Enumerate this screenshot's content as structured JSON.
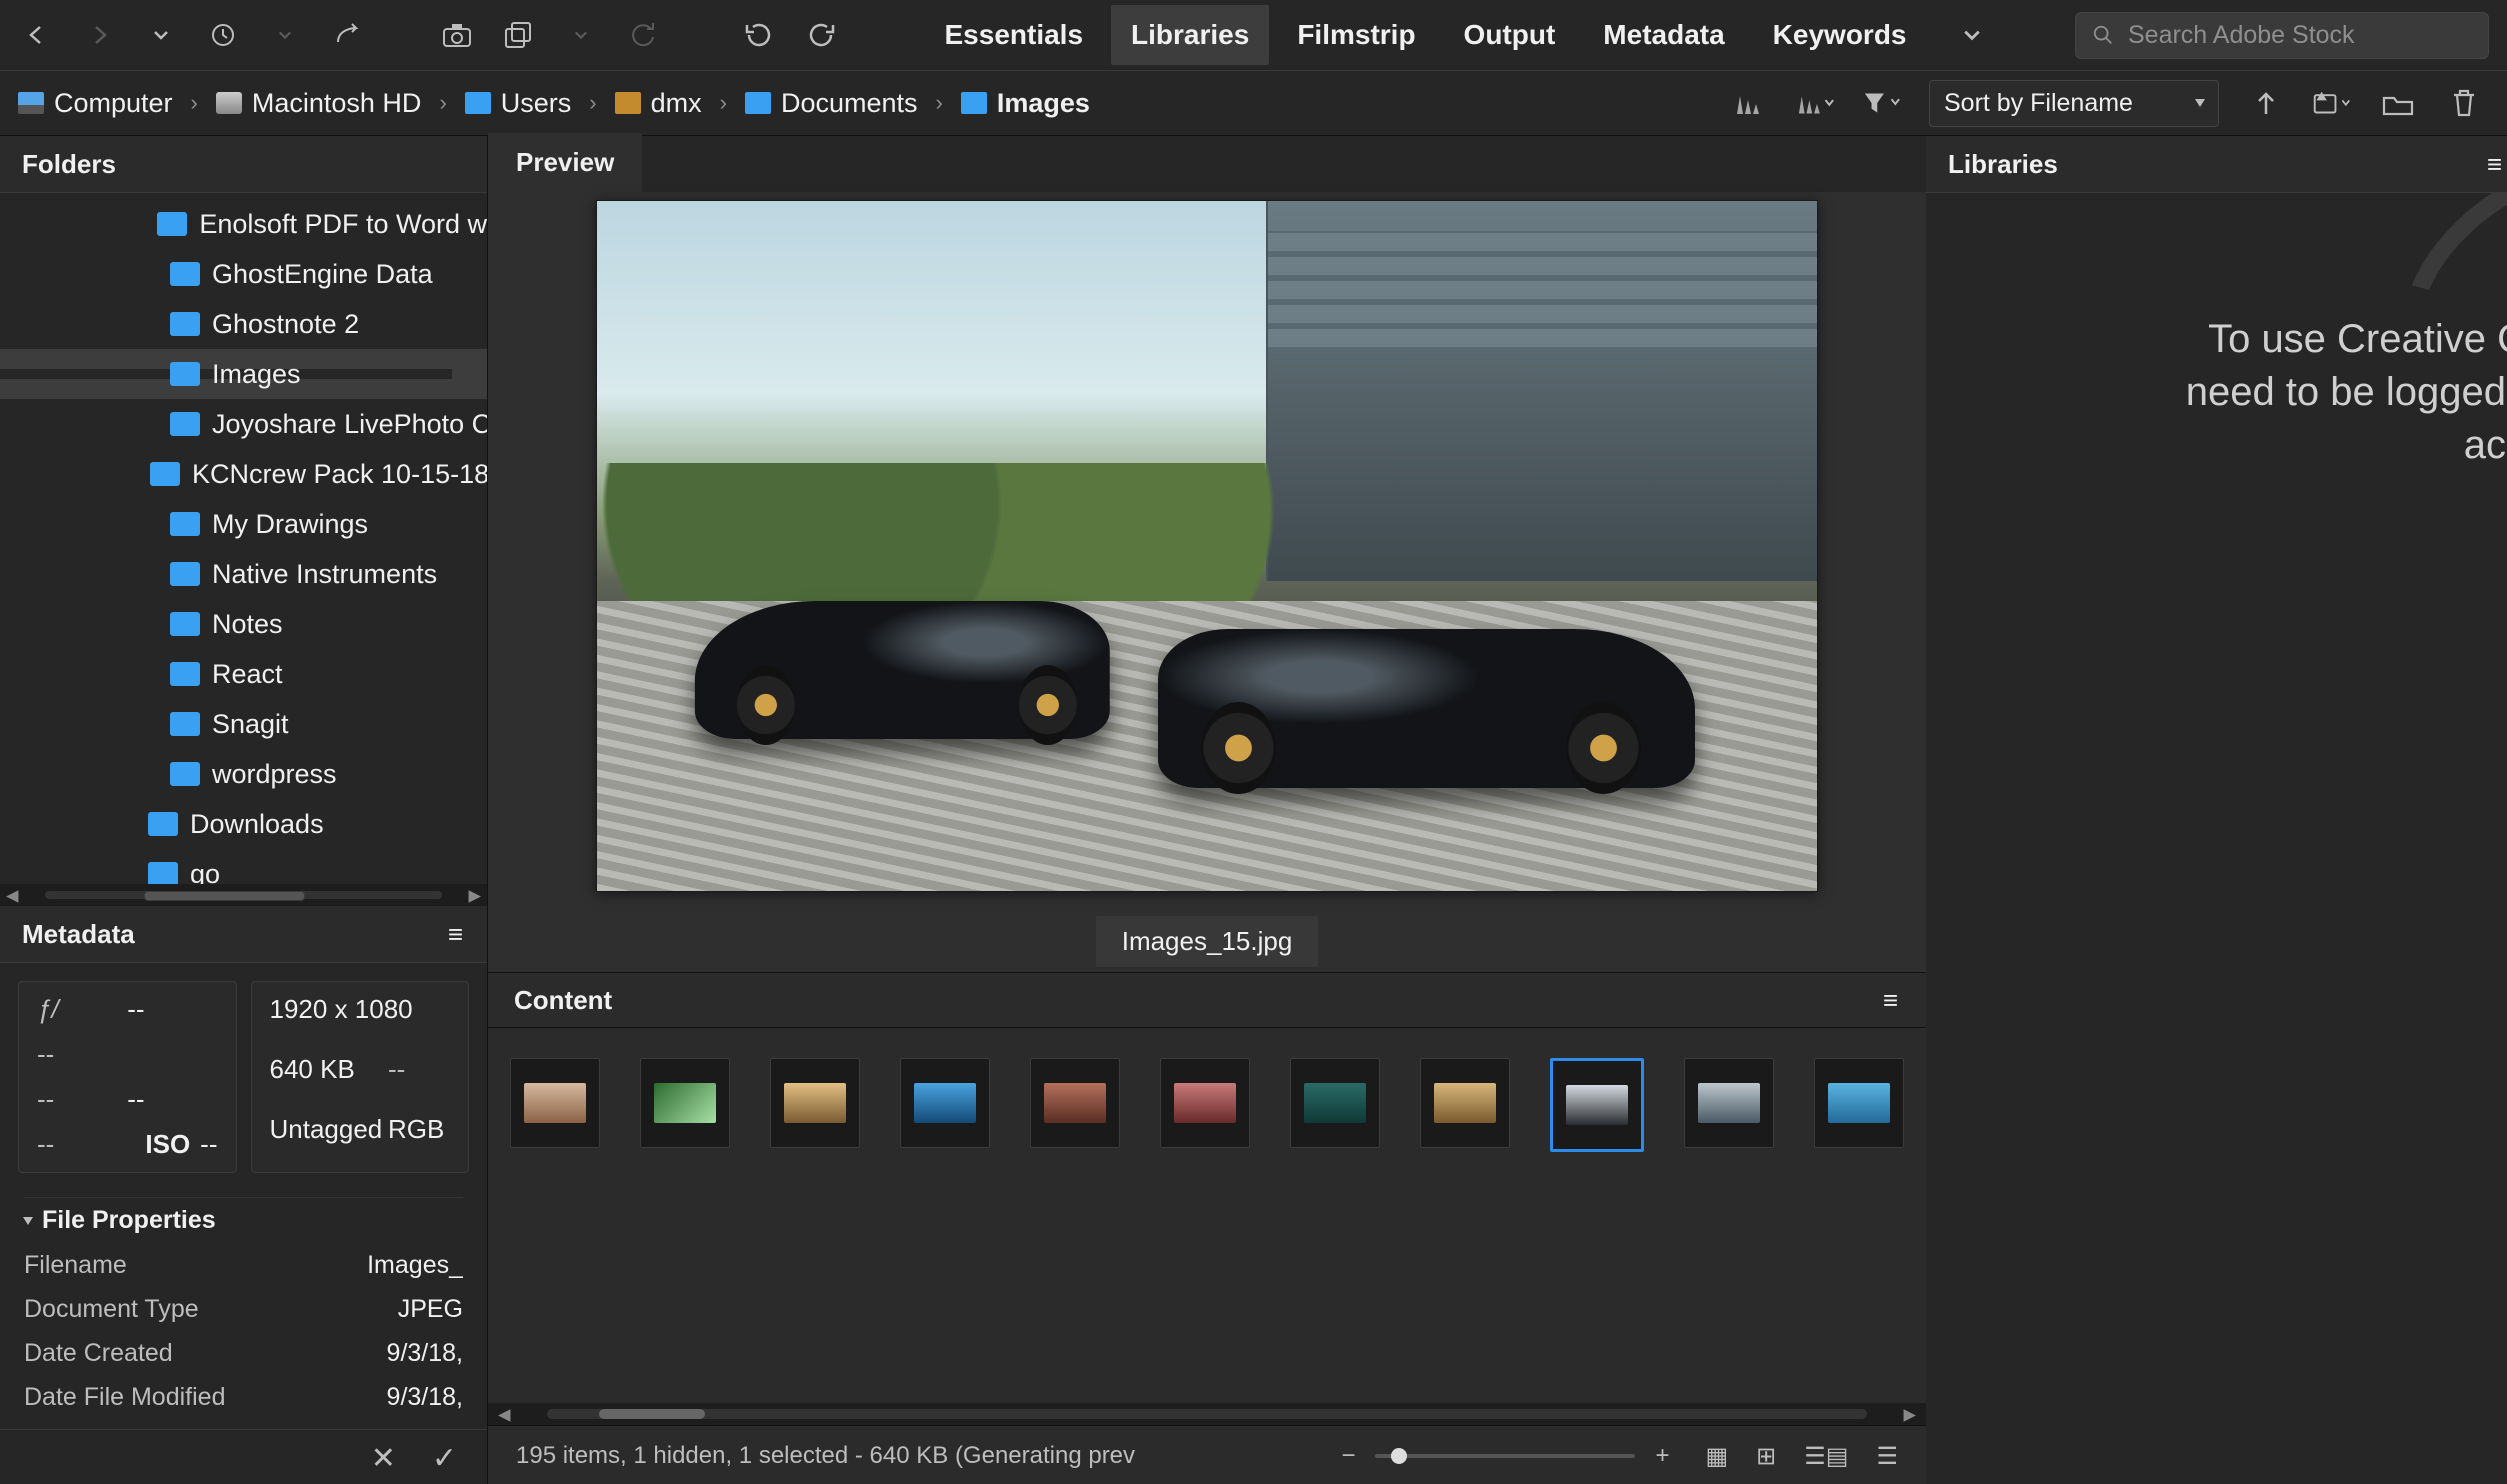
{
  "workspace_tabs": [
    "Essentials",
    "Libraries",
    "Filmstrip",
    "Output",
    "Metadata",
    "Keywords"
  ],
  "workspace_active": "Libraries",
  "search_placeholder": "Search Adobe Stock",
  "breadcrumb": [
    {
      "label": "Computer",
      "icon": "monitor"
    },
    {
      "label": "Macintosh HD",
      "icon": "disk"
    },
    {
      "label": "Users",
      "icon": "blue"
    },
    {
      "label": "dmx",
      "icon": "home"
    },
    {
      "label": "Documents",
      "icon": "blue"
    },
    {
      "label": "Images",
      "icon": "blue"
    }
  ],
  "sort_label": "Sort by Filename",
  "folders_header": "Folders",
  "folder_tree": [
    {
      "label": "Enolsoft PDF to Word w",
      "expandable": false,
      "selected": false,
      "level": 2
    },
    {
      "label": "GhostEngine Data",
      "expandable": true,
      "selected": false,
      "level": 2
    },
    {
      "label": "Ghostnote 2",
      "expandable": true,
      "selected": false,
      "level": 2
    },
    {
      "label": "Images",
      "expandable": true,
      "selected": true,
      "level": 2
    },
    {
      "label": "Joyoshare LivePhoto Co",
      "expandable": true,
      "selected": false,
      "level": 2
    },
    {
      "label": "KCNcrew Pack 10-15-18",
      "expandable": false,
      "selected": false,
      "level": 2
    },
    {
      "label": "My Drawings",
      "expandable": false,
      "selected": false,
      "level": 2
    },
    {
      "label": "Native Instruments",
      "expandable": true,
      "selected": false,
      "level": 2
    },
    {
      "label": "Notes",
      "expandable": false,
      "selected": false,
      "level": 2
    },
    {
      "label": "React",
      "expandable": true,
      "selected": false,
      "level": 2
    },
    {
      "label": "Snagit",
      "expandable": false,
      "selected": false,
      "level": 2
    },
    {
      "label": "wordpress",
      "expandable": false,
      "selected": false,
      "level": 2
    },
    {
      "label": "Downloads",
      "expandable": true,
      "selected": false,
      "level": 1
    },
    {
      "label": "go",
      "expandable": true,
      "selected": false,
      "level": 1
    }
  ],
  "metadata_header": "Metadata",
  "meta_left": {
    "aperture_label": "ƒ/",
    "aperture_value": "--",
    "shutter_value": "--",
    "ev_label": "--",
    "ev_value": "--",
    "iso_label_1": "--",
    "iso_label_2": "ISO",
    "iso_value": "--"
  },
  "meta_right": {
    "dimensions": "1920 x 1080",
    "filesize": "640 KB",
    "bitdepth": "--",
    "profile": "Untagged",
    "mode": "RGB"
  },
  "file_props_header": "File Properties",
  "file_props": [
    {
      "k": "Filename",
      "v": "Images_"
    },
    {
      "k": "Document Type",
      "v": "JPEG"
    },
    {
      "k": "Date Created",
      "v": "9/3/18,"
    },
    {
      "k": "Date File Modified",
      "v": "9/3/18,"
    }
  ],
  "preview_header": "Preview",
  "preview_filename": "Images_15.jpg",
  "content_header": "Content",
  "thumbnails": [
    "a",
    "b",
    "c",
    "d",
    "e",
    "f",
    "g",
    "h",
    "i",
    "j",
    "k"
  ],
  "thumbnail_selected_index": 8,
  "status_text": "195 items, 1 hidden, 1 selected - 640 KB (Generating prev",
  "libraries_header": "Libraries",
  "libraries_message": [
    "To use Creative C",
    "need to be logged i",
    "acc"
  ]
}
